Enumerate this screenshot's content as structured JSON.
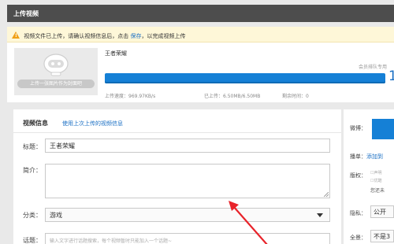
{
  "header": {
    "title": "上传视频"
  },
  "notice": {
    "icon": "warning-icon",
    "text_before": "视频文件已上传，请确认视频信息后，点击",
    "link": "保存",
    "text_after": "，以完成视频上传"
  },
  "upload": {
    "thumbnail_label": "上传一张图片作为封面吧",
    "video_name": "王者荣耀",
    "member_text": "会员排队专用",
    "progress": 1.0,
    "percent_text": "1",
    "speed": "上传速度：969.97KB/s",
    "uploaded": "已上传：6.50MB/6.50MB",
    "remaining": "剩余时间：0"
  },
  "form": {
    "section_title": "视频信息",
    "reuse_link": "使用上次上传的视频信息",
    "title_label": "标题：",
    "title_value": "王者荣耀",
    "desc_label": "简介：",
    "category_label": "分类：",
    "category_value": "游戏",
    "topic_label": "话题：",
    "topic_placeholder": "输入文字进行话题搜索，每个视频暂时只能加入一个话题~"
  },
  "side": {
    "weibo_label": "微博：",
    "playlist_label": "播单：",
    "playlist_link": "添加到",
    "copyright_label": "版权：",
    "copyright_opt1": "声明",
    "copyright_opt2": "优酷",
    "copyright_note": "您还未",
    "privacy_label": "隐私：",
    "privacy_value": "公开",
    "panorama_label": "全景：",
    "panorama_value": "不是3"
  },
  "colors": {
    "accent": "#1580d6",
    "link": "#1a6fc4",
    "warning": "#f0a017",
    "arrow": "#e8232a"
  }
}
